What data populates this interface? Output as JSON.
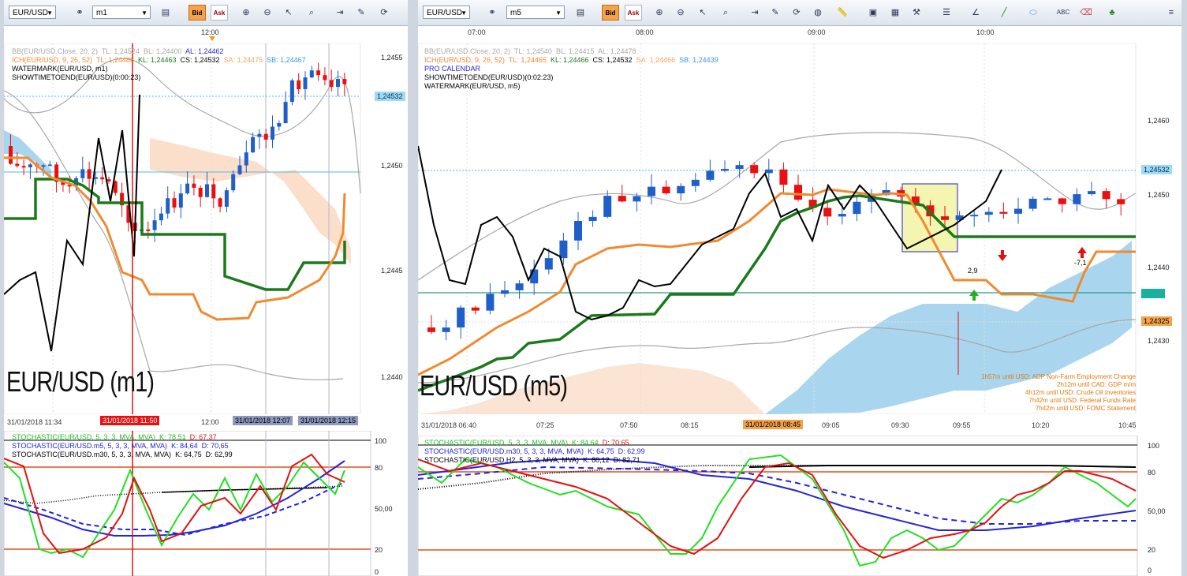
{
  "left": {
    "symbol": "EUR/USD",
    "timeframe": "m1",
    "bid_label": "Bid",
    "ask_label": "Ask",
    "top_time": "12:00",
    "ind_bb": "BB(EUR/USD.Close, 20, 2)",
    "ind_bb_tl": "TL: 1,24524",
    "ind_bb_bl": "BL: 1,24400",
    "ind_bb_al": "AL: 1,24462",
    "ind_ich": "ICH(EUR/USD, 9, 26, 52)",
    "ind_ich_tl": "TL: 1,24486",
    "ind_ich_kl": "KL: 1,24463",
    "ind_ich_cs": "CS: 1,24532",
    "ind_ich_sa": "SA: 1,24475",
    "ind_ich_sb": "SB: 1,24467",
    "ind_wm": "WATERMARK(EUR/USD, m1)",
    "ind_st": "SHOWTIMETOEND(EUR/USD)(0:00:23)",
    "watermark": "EUR/USD (m1)",
    "prices": [
      "1,2455",
      "1,2450",
      "1,2445",
      "1,2440"
    ],
    "current_price": "1,24532",
    "time_labels": [
      "31/01/2018 11:34",
      "12:00"
    ],
    "cursor_time": "31/01/2018 11:50",
    "range_time": "31/01/2018 12:07",
    "range_time2": "31/01/2018 12:15",
    "stoch1": "STOCHASTIC(EUR/USD, 5, 3, 3, MVA, MVA)",
    "stoch1_k": "K: 78,51",
    "stoch1_d": "D: 67,37",
    "stoch2": "STOCHASTIC(EUR/USD.m5, 5, 3, 3, MVA, MVA)",
    "stoch2_k": "K: 84,64",
    "stoch2_d": "D: 70,65",
    "stoch3": "STOCHASTIC(EUR/USD.m30, 5, 3, 3, MVA, MVA)",
    "stoch3_k": "K: 64,75",
    "stoch3_d": "D: 62,99",
    "osc_levels": [
      "100",
      "80",
      "50,00",
      "20",
      "0"
    ]
  },
  "right": {
    "symbol": "EUR/USD",
    "timeframe": "m5",
    "bid_label": "Bid",
    "ask_label": "Ask",
    "top_times": [
      "07:00",
      "08:00",
      "09:00",
      "10:00"
    ],
    "ind_bb": "BB(EUR/USD.Close, 20, 2)",
    "ind_bb_tl": "TL: 1,24540",
    "ind_bb_bl": "BL: 1,24415",
    "ind_bb_al": "AL: 1,24478",
    "ind_ich": "ICH(EUR/USD, 9, 26, 52)",
    "ind_ich_tl": "TL: 1,24465",
    "ind_ich_kl": "KL: 1,24466",
    "ind_ich_cs": "CS: 1,24532",
    "ind_ich_sa": "SA: 1,24466",
    "ind_ich_sb": "SB: 1,24439",
    "ind_pc": "PRO CALENDAR",
    "ind_st": "SHOWTIMETOEND(EUR/USD)(0:02:23)",
    "ind_wm": "WATERMARK(EUR/USD, m5)",
    "watermark": "EUR/USD (m5)",
    "prices": [
      "1,2460",
      "1,2450",
      "1,2440",
      "1,2430"
    ],
    "current_price": "1,24532",
    "level_price": "1,24325",
    "calendar": [
      "1h57m until USD: ADP Non-Farm Employment Change",
      "2h12m until CAD: GDP m/m",
      "4h12m until USD: Crude Oil Inventories",
      "7h42m until USD: Federal Funds Rate",
      "7h42m until USD: FOMC Statement"
    ],
    "marker_up": "2,9",
    "marker_down": "-7,1",
    "time_labels": [
      "31/01/2018 06:40",
      "07:25",
      "07:50",
      "08:15",
      "09:05",
      "09:30",
      "09:55",
      "10:20",
      "10:45"
    ],
    "cursor_time": "31/01/2018 08:45",
    "stoch1": "STOCHASTIC(EUR/USD, 5, 3, 3, MVA, MVA)",
    "stoch1_k": "K: 84,64",
    "stoch1_d": "D: 70,65",
    "stoch2": "STOCHASTIC(EUR/USD.m30, 5, 3, 3, MVA, MVA)",
    "stoch2_k": "K: 64,75",
    "stoch2_d": "D: 62,99",
    "stoch3": "STOCHASTIC(EUR/USD.H2, 5, 3, 3, MVA, MVA)",
    "stoch3_k": "K: 80,12",
    "stoch3_d": "D: 82,71",
    "osc_levels": [
      "100",
      "80",
      "50,00",
      "20",
      "0"
    ]
  },
  "colors": {
    "up_candle": "#1f5fc8",
    "down_candle": "#e81010",
    "tenkan": "#f08a30",
    "kijun": "#1b7a1b",
    "bb": "#a8a8a8",
    "cloud_bull": "#a9d6ee",
    "cloud_bear": "#fbd9c2",
    "stoch_k": "#22e022",
    "stoch_d": "#e41010",
    "stoch_blue": "#2424d8"
  }
}
